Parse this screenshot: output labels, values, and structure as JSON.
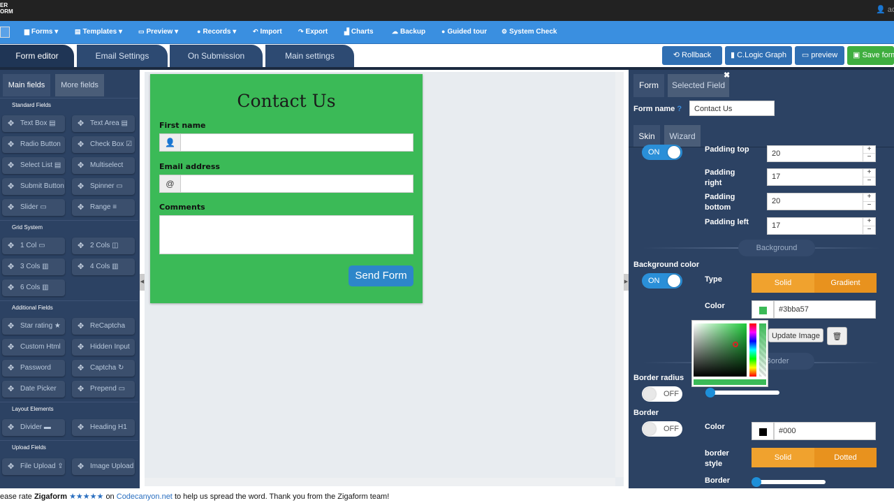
{
  "topbar": {
    "brand_line1": "ER",
    "brand_line2": "ORM",
    "user": "adm"
  },
  "menu": [
    {
      "label": "Forms",
      "icon": "file-icon",
      "dropdown": "▾"
    },
    {
      "label": "Templates",
      "icon": "template-icon",
      "dropdown": "▾"
    },
    {
      "label": "Preview",
      "icon": "monitor-icon",
      "dropdown": "▾"
    },
    {
      "label": "Records",
      "icon": "question-icon",
      "dropdown": "▾"
    },
    {
      "label": "Import",
      "icon": "reply-icon"
    },
    {
      "label": "Export",
      "icon": "share-icon"
    },
    {
      "label": "Charts",
      "icon": "chart-icon"
    },
    {
      "label": "Backup",
      "icon": "cloud-icon"
    },
    {
      "label": "Guided tour",
      "icon": "question-icon"
    },
    {
      "label": "System Check",
      "icon": "gear-icon"
    }
  ],
  "editor_tabs": [
    "Form editor",
    "Email Settings",
    "On Submission",
    "Main settings"
  ],
  "header_buttons": {
    "rollback": "Rollback",
    "clogic": "C.Logic Graph",
    "preview": "preview",
    "save": "Save form"
  },
  "left": {
    "tabs": [
      "Main fields",
      "More fields"
    ],
    "standard_title": "Standard Fields",
    "standard": [
      "Text Box",
      "Text Area",
      "Radio Button",
      "Check Box",
      "Select List",
      "Multiselect",
      "Submit Button",
      "Spinner",
      "Slider",
      "Range"
    ],
    "grid_title": "Grid System",
    "grid": [
      "1 Col",
      "2 Cols",
      "3 Cols",
      "4 Cols",
      "6 Cols"
    ],
    "additional_title": "Additional Fields",
    "additional": [
      "Star rating",
      "ReCaptcha",
      "Custom Html",
      "Hidden Input",
      "Password",
      "Captcha",
      "Date Picker",
      "Prepend"
    ],
    "layout_title": "Layout Elements",
    "layout": [
      "Divider",
      "Heading H1"
    ],
    "upload_title": "Upload Fields",
    "upload": [
      "File Upload",
      "Image Upload"
    ]
  },
  "form": {
    "title": "Contact Us",
    "first_name_label": "First name",
    "email_label": "Email address",
    "email_addon": "@",
    "comments_label": "Comments",
    "send": "Send Form",
    "bg_color": "#3bba57"
  },
  "right": {
    "tabs": [
      "Form",
      "Selected Field"
    ],
    "form_name_label": "Form name",
    "form_name_value": "Contact Us",
    "subtabs": [
      "Skin",
      "Wizard"
    ],
    "toggle_on": "ON",
    "toggle_off": "OFF",
    "padding_top_label": "Padding top",
    "padding_top": "20",
    "padding_right_label": "Padding right",
    "padding_right": "17",
    "padding_bottom_label": "Padding bottom",
    "padding_bottom": "20",
    "padding_left_label": "Padding left",
    "padding_left": "17",
    "background_pill": "Background",
    "background_color_label": "Background color",
    "type_label": "Type",
    "solid": "Solid",
    "gradient": "Gradient",
    "color_label": "Color",
    "bg_color_value": "#3bba57",
    "update_image": "Update Image",
    "border_pill": "Border",
    "border_radius_label": "Border radius",
    "border_label": "Border",
    "border_color_value": "#000",
    "border_style_label": "border style",
    "dotted": "Dotted",
    "border_width_label": "Border"
  },
  "footer": {
    "prefix": "ease rate",
    "brand": "Zigaform",
    "stars": "★★★★★",
    "on": "on",
    "link": "Codecanyon.net",
    "suffix": "to help us spread the word. Thank you from the Zigaform team!"
  }
}
